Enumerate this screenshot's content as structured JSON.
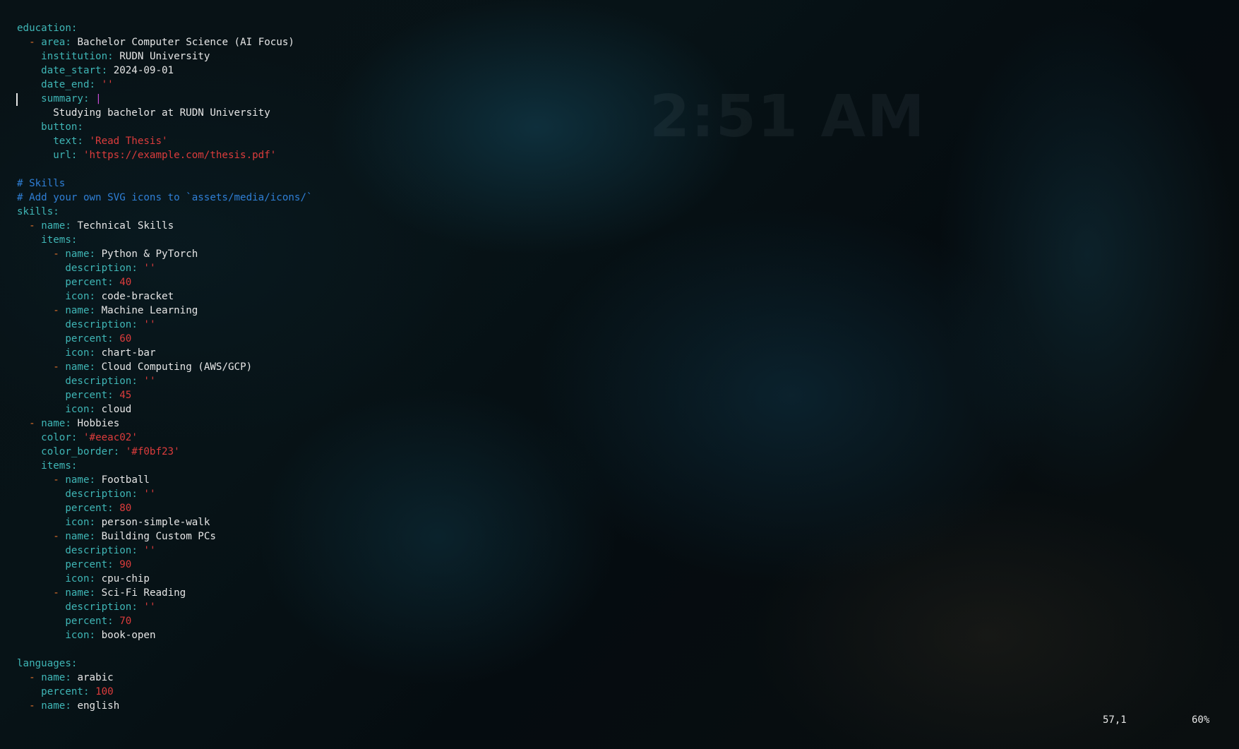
{
  "background": {
    "clock_text": "2:51 AM"
  },
  "editor": {
    "lines": [
      [
        {
          "t": "education",
          "c": "key"
        },
        {
          "t": ":",
          "c": "key"
        }
      ],
      [
        {
          "t": "  ",
          "c": "plain"
        },
        {
          "t": "-",
          "c": "dash"
        },
        {
          "t": " ",
          "c": "plain"
        },
        {
          "t": "area",
          "c": "key"
        },
        {
          "t": ": ",
          "c": "key"
        },
        {
          "t": "Bachelor Computer Science (AI Focus)",
          "c": "plain"
        }
      ],
      [
        {
          "t": "    ",
          "c": "plain"
        },
        {
          "t": "institution",
          "c": "key"
        },
        {
          "t": ": ",
          "c": "key"
        },
        {
          "t": "RUDN University",
          "c": "plain"
        }
      ],
      [
        {
          "t": "    ",
          "c": "plain"
        },
        {
          "t": "date_start",
          "c": "key"
        },
        {
          "t": ": ",
          "c": "key"
        },
        {
          "t": "2024-09-01",
          "c": "plain"
        }
      ],
      [
        {
          "t": "    ",
          "c": "plain"
        },
        {
          "t": "date_end",
          "c": "key"
        },
        {
          "t": ": ",
          "c": "key"
        },
        {
          "t": "''",
          "c": "str"
        }
      ],
      [
        {
          "t": "    ",
          "c": "plain"
        },
        {
          "t": "summary",
          "c": "key"
        },
        {
          "t": ": ",
          "c": "key"
        },
        {
          "t": "|",
          "c": "pipe"
        }
      ],
      [
        {
          "t": "      ",
          "c": "plain"
        },
        {
          "t": "Studying bachelor at RUDN University",
          "c": "plain"
        }
      ],
      [
        {
          "t": "    ",
          "c": "plain"
        },
        {
          "t": "button",
          "c": "key"
        },
        {
          "t": ":",
          "c": "key"
        }
      ],
      [
        {
          "t": "      ",
          "c": "plain"
        },
        {
          "t": "text",
          "c": "key"
        },
        {
          "t": ": ",
          "c": "key"
        },
        {
          "t": "'Read Thesis'",
          "c": "str"
        }
      ],
      [
        {
          "t": "      ",
          "c": "plain"
        },
        {
          "t": "url",
          "c": "key"
        },
        {
          "t": ": ",
          "c": "key"
        },
        {
          "t": "'https://example.com/thesis.pdf'",
          "c": "str"
        }
      ],
      [],
      [
        {
          "t": "# Skills",
          "c": "cmt"
        }
      ],
      [
        {
          "t": "# Add your own SVG icons to `assets/media/icons/`",
          "c": "cmt"
        }
      ],
      [
        {
          "t": "skills",
          "c": "key"
        },
        {
          "t": ":",
          "c": "key"
        }
      ],
      [
        {
          "t": "  ",
          "c": "plain"
        },
        {
          "t": "-",
          "c": "dash"
        },
        {
          "t": " ",
          "c": "plain"
        },
        {
          "t": "name",
          "c": "key"
        },
        {
          "t": ": ",
          "c": "key"
        },
        {
          "t": "Technical Skills",
          "c": "plain"
        }
      ],
      [
        {
          "t": "    ",
          "c": "plain"
        },
        {
          "t": "items",
          "c": "key"
        },
        {
          "t": ":",
          "c": "key"
        }
      ],
      [
        {
          "t": "      ",
          "c": "plain"
        },
        {
          "t": "-",
          "c": "dash"
        },
        {
          "t": " ",
          "c": "plain"
        },
        {
          "t": "name",
          "c": "key"
        },
        {
          "t": ": ",
          "c": "key"
        },
        {
          "t": "Python & PyTorch",
          "c": "plain"
        }
      ],
      [
        {
          "t": "        ",
          "c": "plain"
        },
        {
          "t": "description",
          "c": "key"
        },
        {
          "t": ": ",
          "c": "key"
        },
        {
          "t": "''",
          "c": "str"
        }
      ],
      [
        {
          "t": "        ",
          "c": "plain"
        },
        {
          "t": "percent",
          "c": "key"
        },
        {
          "t": ": ",
          "c": "key"
        },
        {
          "t": "40",
          "c": "num"
        }
      ],
      [
        {
          "t": "        ",
          "c": "plain"
        },
        {
          "t": "icon",
          "c": "key"
        },
        {
          "t": ": ",
          "c": "key"
        },
        {
          "t": "code-bracket",
          "c": "plain"
        }
      ],
      [
        {
          "t": "      ",
          "c": "plain"
        },
        {
          "t": "-",
          "c": "dash"
        },
        {
          "t": " ",
          "c": "plain"
        },
        {
          "t": "name",
          "c": "key"
        },
        {
          "t": ": ",
          "c": "key"
        },
        {
          "t": "Machine Learning",
          "c": "plain"
        }
      ],
      [
        {
          "t": "        ",
          "c": "plain"
        },
        {
          "t": "description",
          "c": "key"
        },
        {
          "t": ": ",
          "c": "key"
        },
        {
          "t": "''",
          "c": "str"
        }
      ],
      [
        {
          "t": "        ",
          "c": "plain"
        },
        {
          "t": "percent",
          "c": "key"
        },
        {
          "t": ": ",
          "c": "key"
        },
        {
          "t": "60",
          "c": "num"
        }
      ],
      [
        {
          "t": "        ",
          "c": "plain"
        },
        {
          "t": "icon",
          "c": "key"
        },
        {
          "t": ": ",
          "c": "key"
        },
        {
          "t": "chart-bar",
          "c": "plain"
        }
      ],
      [
        {
          "t": "      ",
          "c": "plain"
        },
        {
          "t": "-",
          "c": "dash"
        },
        {
          "t": " ",
          "c": "plain"
        },
        {
          "t": "name",
          "c": "key"
        },
        {
          "t": ": ",
          "c": "key"
        },
        {
          "t": "Cloud Computing (AWS/GCP)",
          "c": "plain"
        }
      ],
      [
        {
          "t": "        ",
          "c": "plain"
        },
        {
          "t": "description",
          "c": "key"
        },
        {
          "t": ": ",
          "c": "key"
        },
        {
          "t": "''",
          "c": "str"
        }
      ],
      [
        {
          "t": "        ",
          "c": "plain"
        },
        {
          "t": "percent",
          "c": "key"
        },
        {
          "t": ": ",
          "c": "key"
        },
        {
          "t": "45",
          "c": "num"
        }
      ],
      [
        {
          "t": "        ",
          "c": "plain"
        },
        {
          "t": "icon",
          "c": "key"
        },
        {
          "t": ": ",
          "c": "key"
        },
        {
          "t": "cloud",
          "c": "plain"
        }
      ],
      [
        {
          "t": "  ",
          "c": "plain"
        },
        {
          "t": "-",
          "c": "dash"
        },
        {
          "t": " ",
          "c": "plain"
        },
        {
          "t": "name",
          "c": "key"
        },
        {
          "t": ": ",
          "c": "key"
        },
        {
          "t": "Hobbies",
          "c": "plain"
        }
      ],
      [
        {
          "t": "    ",
          "c": "plain"
        },
        {
          "t": "color",
          "c": "key"
        },
        {
          "t": ": ",
          "c": "key"
        },
        {
          "t": "'#eeac02'",
          "c": "str"
        }
      ],
      [
        {
          "t": "    ",
          "c": "plain"
        },
        {
          "t": "color_border",
          "c": "key"
        },
        {
          "t": ": ",
          "c": "key"
        },
        {
          "t": "'#f0bf23'",
          "c": "str"
        }
      ],
      [
        {
          "t": "    ",
          "c": "plain"
        },
        {
          "t": "items",
          "c": "key"
        },
        {
          "t": ":",
          "c": "key"
        }
      ],
      [
        {
          "t": "      ",
          "c": "plain"
        },
        {
          "t": "-",
          "c": "dash"
        },
        {
          "t": " ",
          "c": "plain"
        },
        {
          "t": "name",
          "c": "key"
        },
        {
          "t": ": ",
          "c": "key"
        },
        {
          "t": "Football",
          "c": "plain"
        }
      ],
      [
        {
          "t": "        ",
          "c": "plain"
        },
        {
          "t": "description",
          "c": "key"
        },
        {
          "t": ": ",
          "c": "key"
        },
        {
          "t": "''",
          "c": "str"
        }
      ],
      [
        {
          "t": "        ",
          "c": "plain"
        },
        {
          "t": "percent",
          "c": "key"
        },
        {
          "t": ": ",
          "c": "key"
        },
        {
          "t": "80",
          "c": "num"
        }
      ],
      [
        {
          "t": "        ",
          "c": "plain"
        },
        {
          "t": "icon",
          "c": "key"
        },
        {
          "t": ": ",
          "c": "key"
        },
        {
          "t": "person-simple-walk",
          "c": "plain"
        }
      ],
      [
        {
          "t": "      ",
          "c": "plain"
        },
        {
          "t": "-",
          "c": "dash"
        },
        {
          "t": " ",
          "c": "plain"
        },
        {
          "t": "name",
          "c": "key"
        },
        {
          "t": ": ",
          "c": "key"
        },
        {
          "t": "Building Custom PCs",
          "c": "plain"
        }
      ],
      [
        {
          "t": "        ",
          "c": "plain"
        },
        {
          "t": "description",
          "c": "key"
        },
        {
          "t": ": ",
          "c": "key"
        },
        {
          "t": "''",
          "c": "str"
        }
      ],
      [
        {
          "t": "        ",
          "c": "plain"
        },
        {
          "t": "percent",
          "c": "key"
        },
        {
          "t": ": ",
          "c": "key"
        },
        {
          "t": "90",
          "c": "num"
        }
      ],
      [
        {
          "t": "        ",
          "c": "plain"
        },
        {
          "t": "icon",
          "c": "key"
        },
        {
          "t": ": ",
          "c": "key"
        },
        {
          "t": "cpu-chip",
          "c": "plain"
        }
      ],
      [
        {
          "t": "      ",
          "c": "plain"
        },
        {
          "t": "-",
          "c": "dash"
        },
        {
          "t": " ",
          "c": "plain"
        },
        {
          "t": "name",
          "c": "key"
        },
        {
          "t": ": ",
          "c": "key"
        },
        {
          "t": "Sci-Fi Reading",
          "c": "plain"
        }
      ],
      [
        {
          "t": "        ",
          "c": "plain"
        },
        {
          "t": "description",
          "c": "key"
        },
        {
          "t": ": ",
          "c": "key"
        },
        {
          "t": "''",
          "c": "str"
        }
      ],
      [
        {
          "t": "        ",
          "c": "plain"
        },
        {
          "t": "percent",
          "c": "key"
        },
        {
          "t": ": ",
          "c": "key"
        },
        {
          "t": "70",
          "c": "num"
        }
      ],
      [
        {
          "t": "        ",
          "c": "plain"
        },
        {
          "t": "icon",
          "c": "key"
        },
        {
          "t": ": ",
          "c": "key"
        },
        {
          "t": "book-open",
          "c": "plain"
        }
      ],
      [],
      [
        {
          "t": "languages",
          "c": "key"
        },
        {
          "t": ":",
          "c": "key"
        }
      ],
      [
        {
          "t": "  ",
          "c": "plain"
        },
        {
          "t": "-",
          "c": "dash"
        },
        {
          "t": " ",
          "c": "plain"
        },
        {
          "t": "name",
          "c": "key"
        },
        {
          "t": ": ",
          "c": "key"
        },
        {
          "t": "arabic",
          "c": "plain"
        }
      ],
      [
        {
          "t": "    ",
          "c": "plain"
        },
        {
          "t": "percent",
          "c": "key"
        },
        {
          "t": ": ",
          "c": "key"
        },
        {
          "t": "100",
          "c": "num"
        }
      ],
      [
        {
          "t": "  ",
          "c": "plain"
        },
        {
          "t": "-",
          "c": "dash"
        },
        {
          "t": " ",
          "c": "plain"
        },
        {
          "t": "name",
          "c": "key"
        },
        {
          "t": ": ",
          "c": "key"
        },
        {
          "t": "english",
          "c": "plain"
        }
      ]
    ]
  },
  "statusline": {
    "cursor_position": "57,1",
    "scroll_percent": "60%"
  },
  "colors": {
    "key": "#3fb6b6",
    "dash": "#e0712b",
    "string": "#dc3c3c",
    "comment": "#2f7fd6",
    "pipe": "#c94bd6",
    "text": "#e6e6e6"
  }
}
